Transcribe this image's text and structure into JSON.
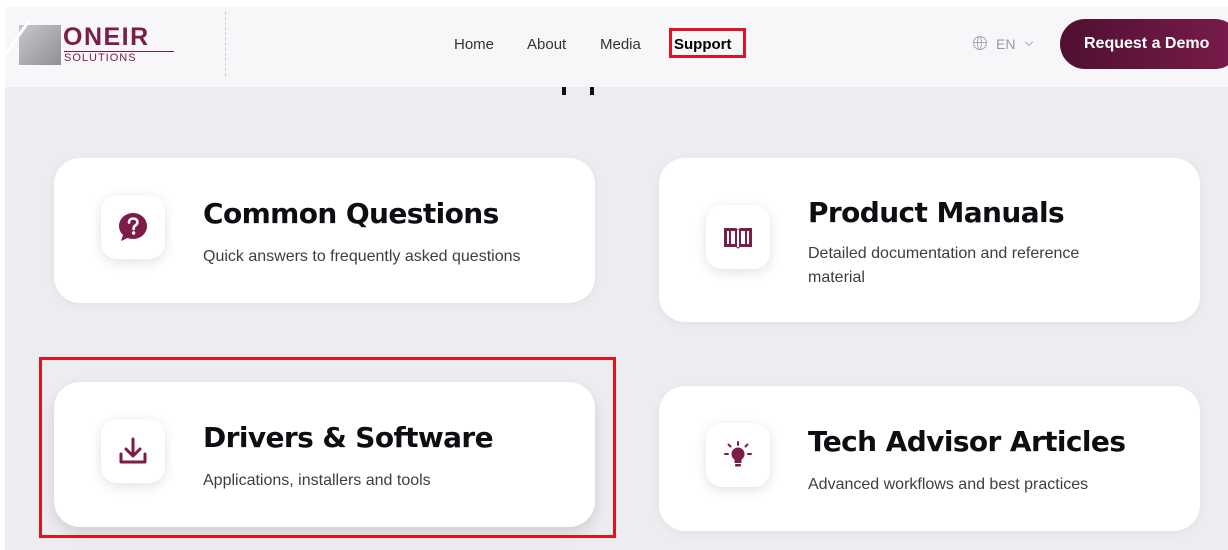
{
  "brand": {
    "name": "ONEIR",
    "tagline": "SOLUTIONS",
    "accent_color": "#7d1b49"
  },
  "nav": {
    "links": [
      {
        "label": "Home",
        "active": false
      },
      {
        "label": "About",
        "active": false
      },
      {
        "label": "Media",
        "active": false
      },
      {
        "label": "Support",
        "active": true
      }
    ],
    "language": {
      "code": "EN",
      "icon": "globe-icon"
    },
    "cta_label": "Request a Demo"
  },
  "cards": [
    {
      "title": "Common Questions",
      "description": "Quick answers to frequently asked questions",
      "icon": "question-bubble-icon"
    },
    {
      "title": "Product Manuals",
      "description": "Detailed documentation and reference material",
      "icon": "open-book-icon"
    },
    {
      "title": "Drivers & Software",
      "description": "Applications, installers and tools",
      "icon": "download-icon"
    },
    {
      "title": "Tech Advisor Articles",
      "description": "Advanced workflows and best practices",
      "icon": "lightbulb-icon"
    }
  ],
  "highlight_color": "#e0141e"
}
